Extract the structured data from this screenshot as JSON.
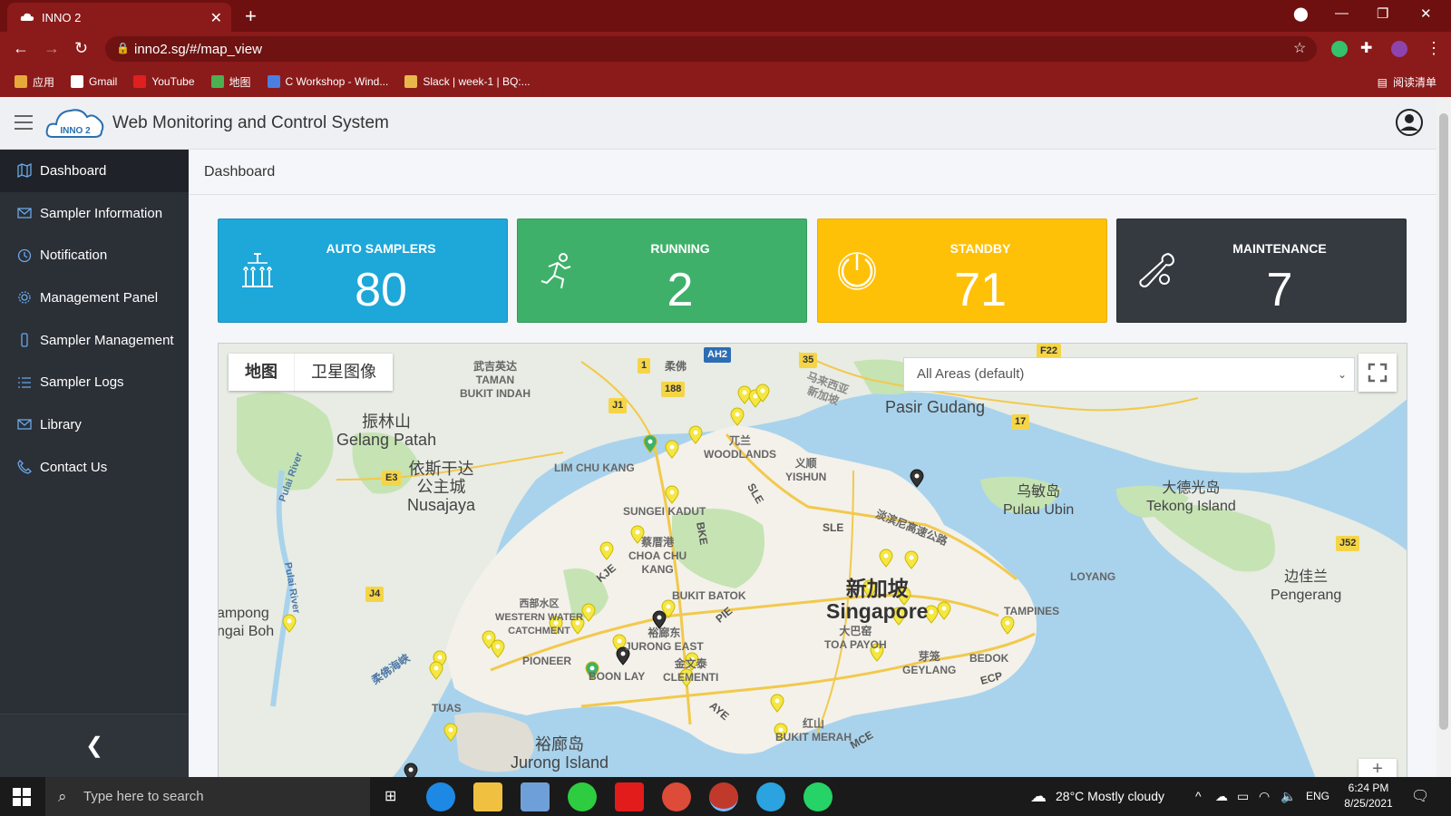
{
  "browser": {
    "tab_title": "INNO 2",
    "url": "inno2.sg/#/map_view",
    "bookmarks": [
      {
        "label": "应用",
        "icon": "apps-grid-icon"
      },
      {
        "label": "Gmail",
        "icon": "gmail-icon"
      },
      {
        "label": "YouTube",
        "icon": "youtube-icon"
      },
      {
        "label": "地图",
        "icon": "maps-icon"
      },
      {
        "label": "C Workshop - Wind...",
        "icon": "docs-icon"
      },
      {
        "label": "Slack | week-1 | BQ:...",
        "icon": "slack-icon"
      }
    ],
    "reading_list": "阅读清单"
  },
  "app": {
    "title": "Web Monitoring and Control System",
    "logo_text": "INNO 2"
  },
  "sidebar": {
    "items": [
      {
        "label": "Dashboard",
        "icon": "map-icon"
      },
      {
        "label": "Sampler Information",
        "icon": "envelope-icon"
      },
      {
        "label": "Notification",
        "icon": "clock-icon"
      },
      {
        "label": "Management Panel",
        "icon": "gear-icon"
      },
      {
        "label": "Sampler Management",
        "icon": "phone-icon"
      },
      {
        "label": "Sampler Logs",
        "icon": "list-icon"
      },
      {
        "label": "Library",
        "icon": "envelope-icon"
      },
      {
        "label": "Contact Us",
        "icon": "phone-handset-icon"
      }
    ]
  },
  "breadcrumb": "Dashboard",
  "cards": [
    {
      "label": "AUTO SAMPLERS",
      "value": "80",
      "color": "#1ea7d9"
    },
    {
      "label": "RUNNING",
      "value": "2",
      "color": "#3fb06a"
    },
    {
      "label": "STANDBY",
      "value": "71",
      "color": "#ffc107"
    },
    {
      "label": "MAINTENANCE",
      "value": "7",
      "color": "#343a40"
    }
  ],
  "map": {
    "type_buttons": [
      "地图",
      "卫星图像"
    ],
    "area_select": "All Areas (default)",
    "labels": {
      "taman": "武吉英达\nTAMAN\nBUKIT INDAH",
      "gelang": "振林山\nGelang Patah",
      "nusajaya": "依斯干达\n公主城\nNusajaya",
      "pasir": "马来西亚\n新加坡",
      "pasir_gudang": "Pasir Gudang",
      "lim_chu_kang": "LIM CHU KANG",
      "woodlands": "兀兰\nWOODLANDS",
      "yishun": "义顺\nYISHUN",
      "sungei_kadut": "SUNGEI KADUT",
      "choa_chu_kang": "蔡厝港\nCHOA CHU\nKANG",
      "bukit_batok": "BUKIT BATOK",
      "western_water": "西部水区\nWESTERN WATER\nCATCHMENT",
      "pioneer": "PIONEER",
      "boon_lay": "BOON LAY",
      "jurong_east": "裕廊东\nJURONG EAST",
      "clementi": "金文泰\nCLEMENTI",
      "tuas": "TUAS",
      "jurong_island": "裕廊岛\nJurong Island",
      "singapore": "新加坡\nSingapore",
      "toa_payoh": "大巴窑\nTOA PAYOH",
      "geylang": "芽笼\nGEYLANG",
      "bedok": "BEDOK",
      "tampines": "TAMPINES",
      "loyang": "LOYANG",
      "pulau_ubin": "乌敏岛\nPulau Ubin",
      "tekong": "大德光岛\nTekong Island",
      "pengerang": "边佳兰\nPengerang",
      "ampong": "ampong\nngai Boh",
      "bukit_merah": "红山\nBUKIT MERAH",
      "tpe_highway": "淡滨尼高速公路",
      "strait": "柔佛海峡",
      "pulai": "Pulai River",
      "pulai2": "Pulai River",
      "sle": "SLE",
      "sle2": "SLE",
      "bke": "BKE",
      "pie": "PIE",
      "aye": "AYE",
      "ecp": "ECP",
      "mce": "MCE",
      "kje": "KJE"
    },
    "roads": {
      "ah2": "AH2",
      "r1": "1",
      "r188": "188",
      "j1": "J1",
      "e3": "E3",
      "j4": "J4",
      "r35": "35",
      "f22": "F22",
      "r17": "17",
      "j52": "J52",
      "rouhu": "柔佛"
    }
  },
  "taskbar": {
    "search_placeholder": "Type here to search",
    "weather": "28°C  Mostly cloudy",
    "lang": "ENG",
    "time": "6:24 PM",
    "date": "8/25/2021"
  }
}
